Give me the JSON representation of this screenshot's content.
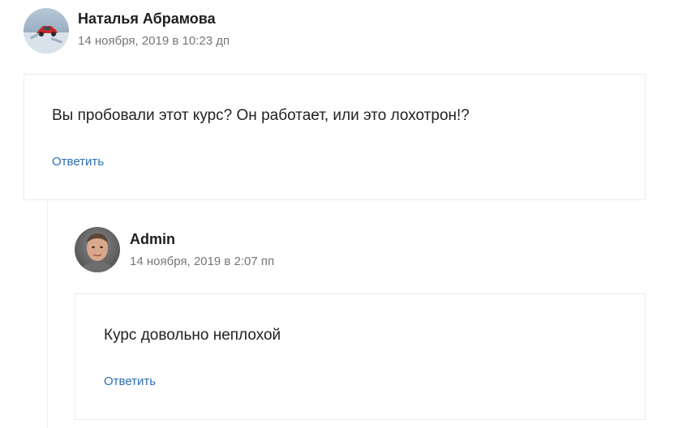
{
  "comments": [
    {
      "author": "Наталья Абрамова",
      "date": "14 ноября, 2019 в 10:23 дп",
      "text": "Вы пробовали этот курс? Он работает, или это лохотрон!?",
      "reply_label": "Ответить",
      "avatar_icon": "car-photo-avatar"
    },
    {
      "author": "Admin",
      "date": "14 ноября, 2019 в 2:07 пп",
      "text": "Курс довольно неплохой",
      "reply_label": "Ответить",
      "avatar_icon": "man-photo-avatar"
    }
  ],
  "colors": {
    "link": "#2e6db4",
    "meta": "#767676",
    "border": "#ececec"
  }
}
